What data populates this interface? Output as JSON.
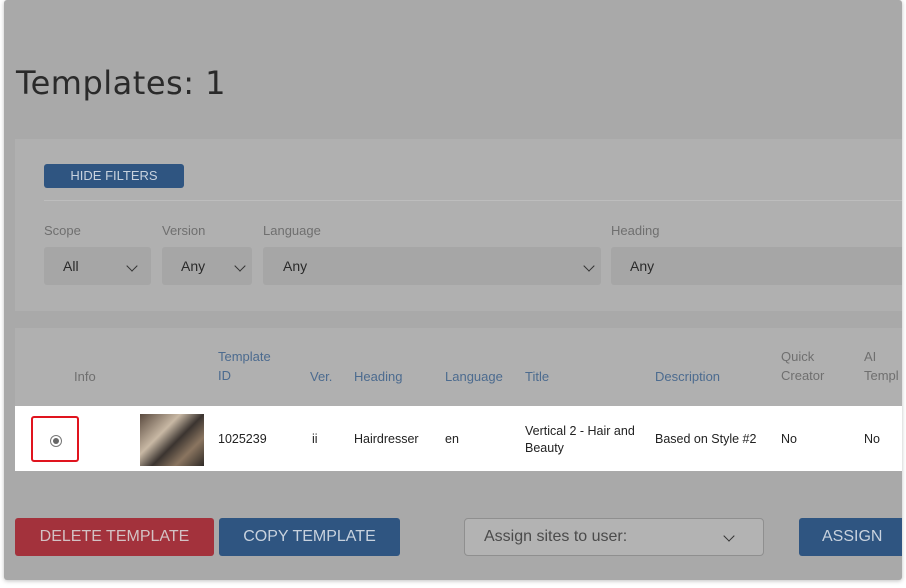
{
  "page_title": "Templates: 1",
  "filters": {
    "hide_button": "HIDE FILTERS",
    "scope_label": "Scope",
    "scope_value": "All",
    "version_label": "Version",
    "version_value": "Any",
    "language_label": "Language",
    "language_value": "Any",
    "heading_label": "Heading",
    "heading_value": "Any"
  },
  "table": {
    "columns": {
      "info": "Info",
      "template_id_1": "Template",
      "template_id_2": "ID",
      "ver": "Ver.",
      "heading": "Heading",
      "language": "Language",
      "title": "Title",
      "description": "Description",
      "quick_creator_1": "Quick",
      "quick_creator_2": "Creator",
      "ai_template_1": "AI",
      "ai_template_2": "Templ"
    },
    "rows": [
      {
        "template_id": "1025239",
        "ver": "ii",
        "heading": "Hairdresser",
        "language": "en",
        "title_1": "Vertical 2 - Hair and",
        "title_2": "Beauty",
        "description": "Based on Style #2",
        "quick_creator": "No",
        "ai_template": "No"
      }
    ]
  },
  "actions": {
    "delete_label": "DELETE TEMPLATE",
    "copy_label": "COPY TEMPLATE",
    "assign_select_placeholder": "Assign sites to user:",
    "assign_label": "ASSIGN"
  }
}
